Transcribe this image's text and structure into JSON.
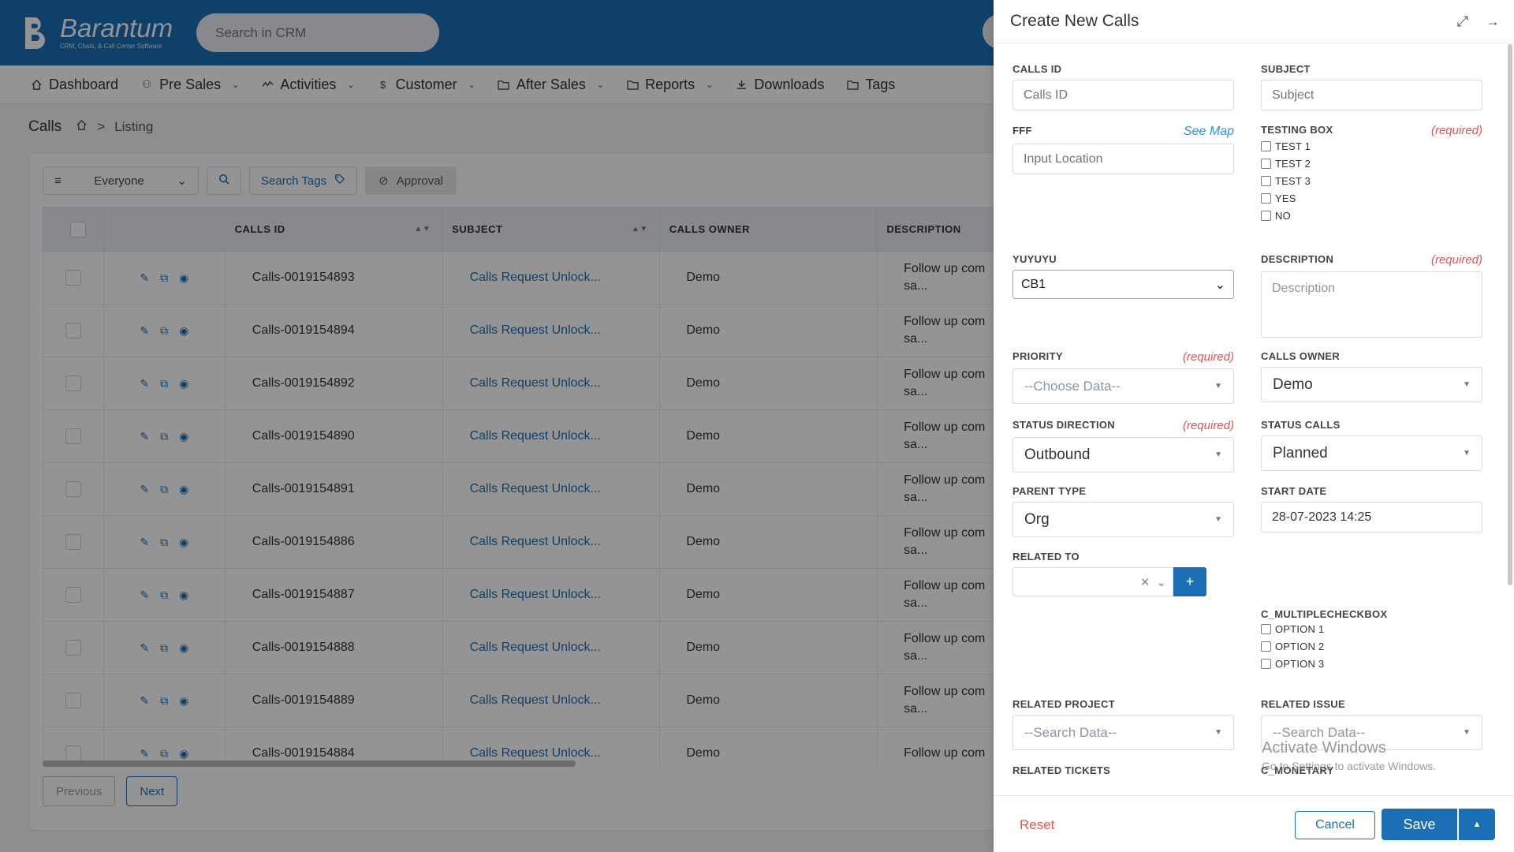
{
  "app": {
    "logo_name": "Barantum",
    "logo_sub": "CRM, Chats, & Call Center Software",
    "search_placeholder": "Search in CRM"
  },
  "nav": [
    {
      "label": "Dashboard",
      "icon": "home-icon",
      "chevron": false
    },
    {
      "label": "Pre Sales",
      "icon": "users-icon",
      "chevron": true
    },
    {
      "label": "Activities",
      "icon": "activity-icon",
      "chevron": true
    },
    {
      "label": "Customer",
      "icon": "dollar-icon",
      "chevron": true
    },
    {
      "label": "After Sales",
      "icon": "folder-icon",
      "chevron": true
    },
    {
      "label": "Reports",
      "icon": "folder-icon",
      "chevron": true
    },
    {
      "label": "Downloads",
      "icon": "download-icon",
      "chevron": false
    },
    {
      "label": "Tags",
      "icon": "folder-icon",
      "chevron": false
    }
  ],
  "page": {
    "title": "Calls",
    "breadcrumb_separator": ">",
    "breadcrumb_current": "Listing"
  },
  "toolbar": {
    "filter_value": "Everyone",
    "search_tags_label": "Search Tags",
    "approval_label": "Approval"
  },
  "table": {
    "columns": [
      "CALLS ID",
      "SUBJECT",
      "CALLS OWNER",
      "DESCRIPTION"
    ],
    "rows": [
      {
        "id": "Calls-0019154893",
        "subject": "Calls Request Unlock...",
        "owner": "Demo",
        "desc1": "Follow up com",
        "desc2": "sa..."
      },
      {
        "id": "Calls-0019154894",
        "subject": "Calls Request Unlock...",
        "owner": "Demo",
        "desc1": "Follow up com",
        "desc2": "sa..."
      },
      {
        "id": "Calls-0019154892",
        "subject": "Calls Request Unlock...",
        "owner": "Demo",
        "desc1": "Follow up com",
        "desc2": "sa..."
      },
      {
        "id": "Calls-0019154890",
        "subject": "Calls Request Unlock...",
        "owner": "Demo",
        "desc1": "Follow up com",
        "desc2": "sa..."
      },
      {
        "id": "Calls-0019154891",
        "subject": "Calls Request Unlock...",
        "owner": "Demo",
        "desc1": "Follow up com",
        "desc2": "sa..."
      },
      {
        "id": "Calls-0019154886",
        "subject": "Calls Request Unlock...",
        "owner": "Demo",
        "desc1": "Follow up com",
        "desc2": "sa..."
      },
      {
        "id": "Calls-0019154887",
        "subject": "Calls Request Unlock...",
        "owner": "Demo",
        "desc1": "Follow up com",
        "desc2": "sa..."
      },
      {
        "id": "Calls-0019154888",
        "subject": "Calls Request Unlock...",
        "owner": "Demo",
        "desc1": "Follow up com",
        "desc2": "sa..."
      },
      {
        "id": "Calls-0019154889",
        "subject": "Calls Request Unlock...",
        "owner": "Demo",
        "desc1": "Follow up com",
        "desc2": "sa..."
      },
      {
        "id": "Calls-0019154884",
        "subject": "Calls Request Unlock...",
        "owner": "Demo",
        "desc1": "Follow up com",
        "desc2": ""
      }
    ]
  },
  "pager": {
    "previous": "Previous",
    "next": "Next"
  },
  "panel": {
    "title": "Create New Calls",
    "required_text": "(required)",
    "calls_id": {
      "label": "CALLS ID",
      "placeholder": "Calls ID"
    },
    "subject": {
      "label": "SUBJECT",
      "placeholder": "Subject"
    },
    "fff": {
      "label": "FFF",
      "see_map": "See Map",
      "placeholder": "Input Location"
    },
    "testing_box": {
      "label": "TESTING BOX",
      "options": [
        "TEST 1",
        "TEST 2",
        "TEST 3",
        "YES",
        "NO"
      ]
    },
    "yuyuyu": {
      "label": "YUYUYU",
      "value": "CB1"
    },
    "description": {
      "label": "DESCRIPTION",
      "placeholder": "Description"
    },
    "priority": {
      "label": "PRIORITY",
      "placeholder": "--Choose Data--"
    },
    "calls_owner": {
      "label": "CALLS OWNER",
      "value": "Demo"
    },
    "status_direction": {
      "label": "STATUS DIRECTION",
      "value": "Outbound"
    },
    "status_calls": {
      "label": "STATUS CALLS",
      "value": "Planned"
    },
    "parent_type": {
      "label": "PARENT TYPE",
      "value": "Org"
    },
    "start_date": {
      "label": "START DATE",
      "value": "28-07-2023 14:25"
    },
    "related_to": {
      "label": "RELATED TO",
      "add": "+"
    },
    "c_multiplecheckbox": {
      "label": "C_MULTIPLECHECKBOX",
      "options": [
        "OPTION 1",
        "OPTION 2",
        "OPTION 3"
      ]
    },
    "related_project": {
      "label": "RELATED PROJECT",
      "placeholder": "--Search Data--"
    },
    "related_issue": {
      "label": "RELATED ISSUE",
      "placeholder": "--Search Data--"
    },
    "related_tickets": {
      "label": "RELATED TICKETS"
    },
    "c_monetary": {
      "label": "C_MONETARY"
    },
    "reset": "Reset",
    "cancel": "Cancel",
    "save": "Save"
  },
  "watermark": {
    "line1": "Activate Windows",
    "line2": "Go to Settings to activate Windows."
  },
  "colors": {
    "primary": "#1a6fb5",
    "required": "#e05555",
    "link": "#2f8fd8"
  }
}
